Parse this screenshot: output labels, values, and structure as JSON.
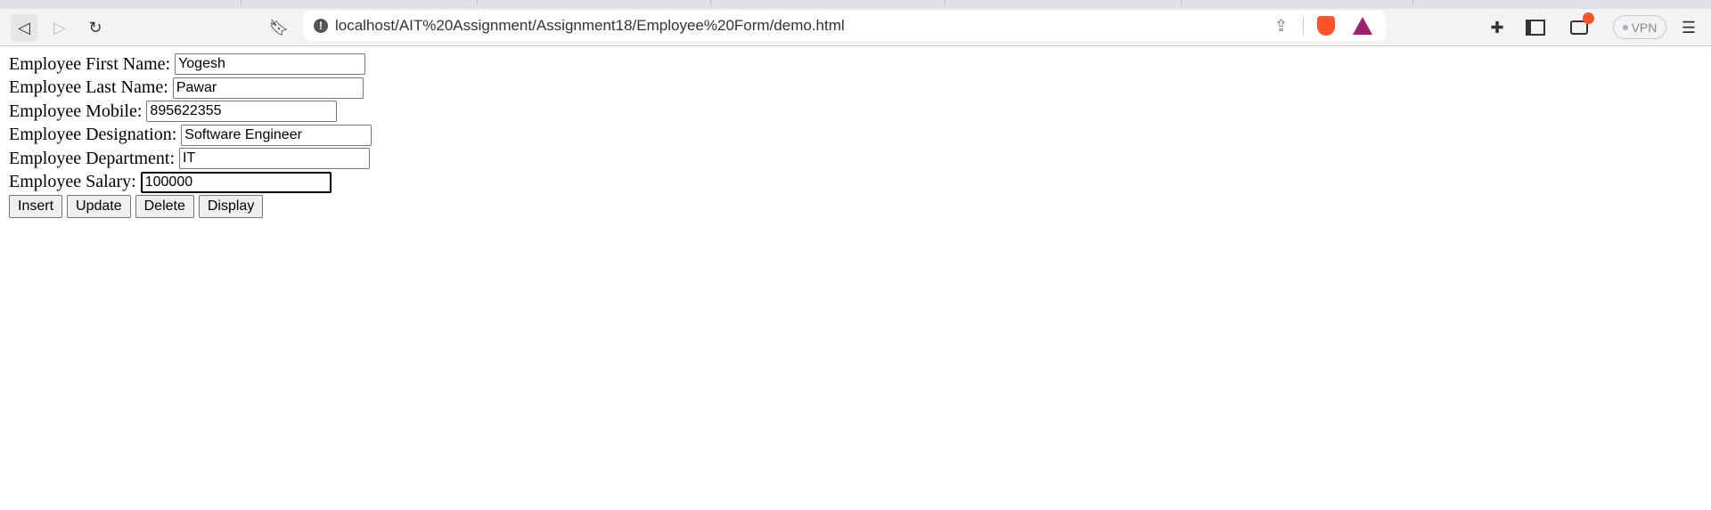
{
  "browser": {
    "url": "localhost/AIT%20Assignment/Assignment18/Employee%20Form/demo.html",
    "vpn_label": "VPN",
    "notification_color": "#fb542b"
  },
  "form": {
    "fields": [
      {
        "label": "Employee First Name:",
        "value": "Yogesh"
      },
      {
        "label": "Employee Last Name:",
        "value": "Pawar"
      },
      {
        "label": "Employee Mobile:",
        "value": "895622355"
      },
      {
        "label": "Employee Designation:",
        "value": "Software Engineer"
      },
      {
        "label": "Employee Department:",
        "value": "IT"
      },
      {
        "label": "Employee Salary:",
        "value": "100000"
      }
    ],
    "buttons": {
      "insert": "Insert",
      "update": "Update",
      "delete": "Delete",
      "display": "Display"
    }
  }
}
